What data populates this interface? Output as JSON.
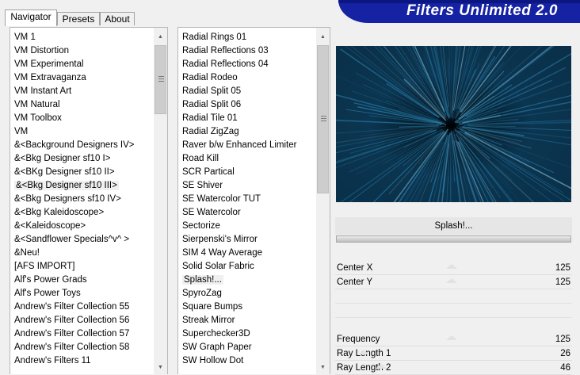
{
  "tabs": [
    "Navigator",
    "Presets",
    "About"
  ],
  "banner": {
    "title": "Filters Unlimited 2.0"
  },
  "categories": [
    "VM 1",
    "VM Distortion",
    "VM Experimental",
    "VM Extravaganza",
    "VM Instant Art",
    "VM Natural",
    "VM Toolbox",
    "VM",
    "&<Background Designers IV>",
    "&<Bkg Designer sf10 I>",
    "&<BKg Designer sf10 II>",
    "&<Bkg Designer sf10 III>",
    "&<Bkg Designers sf10 IV>",
    "&<Bkg Kaleidoscope>",
    "&<Kaleidoscope>",
    "&<Sandflower Specials^v^ >",
    "&Neu!",
    "[AFS IMPORT]",
    "Alf's Power Grads",
    "Alf's Power Toys",
    "Andrew's Filter Collection 55",
    "Andrew's Filter Collection 56",
    "Andrew's Filter Collection 57",
    "Andrew's Filter Collection 58",
    "Andrew's Filters 11"
  ],
  "categories_selected_index": 11,
  "filters": [
    "Radial  Rings 01",
    "Radial Reflections 03",
    "Radial Reflections 04",
    "Radial Rodeo",
    "Radial Split 05",
    "Radial Split 06",
    "Radial Tile 01",
    "Radial ZigZag",
    "Raver b/w Enhanced Limiter",
    "Road Kill",
    "SCR  Partical",
    "SE Shiver",
    "SE Watercolor TUT",
    "SE Watercolor",
    "Sectorize",
    "Sierpenski's Mirror",
    "SIM 4 Way Average",
    "Solid Solar Fabric",
    "Splash!...",
    "SpyroZag",
    "Square Bumps",
    "Streak Mirror",
    "Superchecker3D",
    "SW Graph Paper",
    "SW Hollow Dot"
  ],
  "filters_selected_index": 18,
  "selected_filter": "Splash!...",
  "progress_fraction": 1.0,
  "params": [
    {
      "label": "Center X",
      "value": "125",
      "level": 0.49
    },
    {
      "label": "Center Y",
      "value": "125",
      "level": 0.49
    },
    {
      "label": "Frequency",
      "value": "125",
      "level": 0.49
    },
    {
      "label": "Ray Length 1",
      "value": "26",
      "level": 0.1
    },
    {
      "label": "Ray Length 2",
      "value": "46",
      "level": 0.18
    }
  ],
  "colors": {
    "banner": "#1422a3",
    "preview_bg": "#0a2f48",
    "preview_center": "#000000",
    "preview_rays": "#2f8fc0"
  }
}
